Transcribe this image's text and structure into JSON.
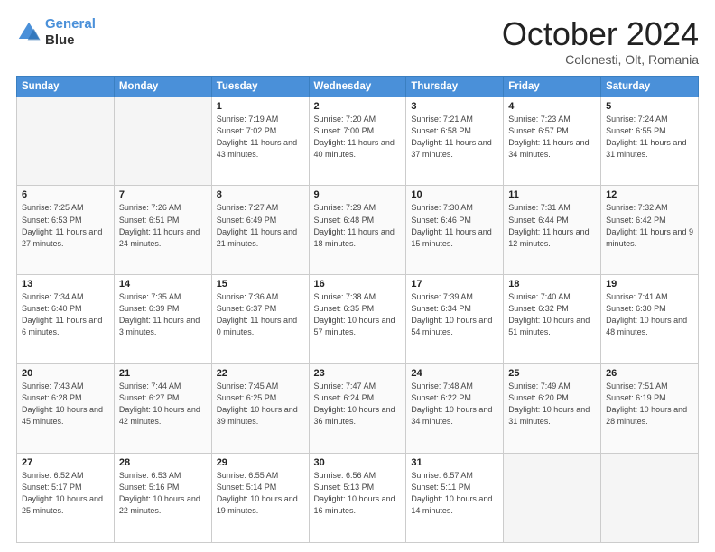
{
  "header": {
    "logo_line1": "General",
    "logo_line2": "Blue",
    "month": "October 2024",
    "location": "Colonesti, Olt, Romania"
  },
  "weekdays": [
    "Sunday",
    "Monday",
    "Tuesday",
    "Wednesday",
    "Thursday",
    "Friday",
    "Saturday"
  ],
  "weeks": [
    [
      {
        "day": "",
        "sunrise": "",
        "sunset": "",
        "daylight": ""
      },
      {
        "day": "",
        "sunrise": "",
        "sunset": "",
        "daylight": ""
      },
      {
        "day": "1",
        "sunrise": "Sunrise: 7:19 AM",
        "sunset": "Sunset: 7:02 PM",
        "daylight": "Daylight: 11 hours and 43 minutes."
      },
      {
        "day": "2",
        "sunrise": "Sunrise: 7:20 AM",
        "sunset": "Sunset: 7:00 PM",
        "daylight": "Daylight: 11 hours and 40 minutes."
      },
      {
        "day": "3",
        "sunrise": "Sunrise: 7:21 AM",
        "sunset": "Sunset: 6:58 PM",
        "daylight": "Daylight: 11 hours and 37 minutes."
      },
      {
        "day": "4",
        "sunrise": "Sunrise: 7:23 AM",
        "sunset": "Sunset: 6:57 PM",
        "daylight": "Daylight: 11 hours and 34 minutes."
      },
      {
        "day": "5",
        "sunrise": "Sunrise: 7:24 AM",
        "sunset": "Sunset: 6:55 PM",
        "daylight": "Daylight: 11 hours and 31 minutes."
      }
    ],
    [
      {
        "day": "6",
        "sunrise": "Sunrise: 7:25 AM",
        "sunset": "Sunset: 6:53 PM",
        "daylight": "Daylight: 11 hours and 27 minutes."
      },
      {
        "day": "7",
        "sunrise": "Sunrise: 7:26 AM",
        "sunset": "Sunset: 6:51 PM",
        "daylight": "Daylight: 11 hours and 24 minutes."
      },
      {
        "day": "8",
        "sunrise": "Sunrise: 7:27 AM",
        "sunset": "Sunset: 6:49 PM",
        "daylight": "Daylight: 11 hours and 21 minutes."
      },
      {
        "day": "9",
        "sunrise": "Sunrise: 7:29 AM",
        "sunset": "Sunset: 6:48 PM",
        "daylight": "Daylight: 11 hours and 18 minutes."
      },
      {
        "day": "10",
        "sunrise": "Sunrise: 7:30 AM",
        "sunset": "Sunset: 6:46 PM",
        "daylight": "Daylight: 11 hours and 15 minutes."
      },
      {
        "day": "11",
        "sunrise": "Sunrise: 7:31 AM",
        "sunset": "Sunset: 6:44 PM",
        "daylight": "Daylight: 11 hours and 12 minutes."
      },
      {
        "day": "12",
        "sunrise": "Sunrise: 7:32 AM",
        "sunset": "Sunset: 6:42 PM",
        "daylight": "Daylight: 11 hours and 9 minutes."
      }
    ],
    [
      {
        "day": "13",
        "sunrise": "Sunrise: 7:34 AM",
        "sunset": "Sunset: 6:40 PM",
        "daylight": "Daylight: 11 hours and 6 minutes."
      },
      {
        "day": "14",
        "sunrise": "Sunrise: 7:35 AM",
        "sunset": "Sunset: 6:39 PM",
        "daylight": "Daylight: 11 hours and 3 minutes."
      },
      {
        "day": "15",
        "sunrise": "Sunrise: 7:36 AM",
        "sunset": "Sunset: 6:37 PM",
        "daylight": "Daylight: 11 hours and 0 minutes."
      },
      {
        "day": "16",
        "sunrise": "Sunrise: 7:38 AM",
        "sunset": "Sunset: 6:35 PM",
        "daylight": "Daylight: 10 hours and 57 minutes."
      },
      {
        "day": "17",
        "sunrise": "Sunrise: 7:39 AM",
        "sunset": "Sunset: 6:34 PM",
        "daylight": "Daylight: 10 hours and 54 minutes."
      },
      {
        "day": "18",
        "sunrise": "Sunrise: 7:40 AM",
        "sunset": "Sunset: 6:32 PM",
        "daylight": "Daylight: 10 hours and 51 minutes."
      },
      {
        "day": "19",
        "sunrise": "Sunrise: 7:41 AM",
        "sunset": "Sunset: 6:30 PM",
        "daylight": "Daylight: 10 hours and 48 minutes."
      }
    ],
    [
      {
        "day": "20",
        "sunrise": "Sunrise: 7:43 AM",
        "sunset": "Sunset: 6:28 PM",
        "daylight": "Daylight: 10 hours and 45 minutes."
      },
      {
        "day": "21",
        "sunrise": "Sunrise: 7:44 AM",
        "sunset": "Sunset: 6:27 PM",
        "daylight": "Daylight: 10 hours and 42 minutes."
      },
      {
        "day": "22",
        "sunrise": "Sunrise: 7:45 AM",
        "sunset": "Sunset: 6:25 PM",
        "daylight": "Daylight: 10 hours and 39 minutes."
      },
      {
        "day": "23",
        "sunrise": "Sunrise: 7:47 AM",
        "sunset": "Sunset: 6:24 PM",
        "daylight": "Daylight: 10 hours and 36 minutes."
      },
      {
        "day": "24",
        "sunrise": "Sunrise: 7:48 AM",
        "sunset": "Sunset: 6:22 PM",
        "daylight": "Daylight: 10 hours and 34 minutes."
      },
      {
        "day": "25",
        "sunrise": "Sunrise: 7:49 AM",
        "sunset": "Sunset: 6:20 PM",
        "daylight": "Daylight: 10 hours and 31 minutes."
      },
      {
        "day": "26",
        "sunrise": "Sunrise: 7:51 AM",
        "sunset": "Sunset: 6:19 PM",
        "daylight": "Daylight: 10 hours and 28 minutes."
      }
    ],
    [
      {
        "day": "27",
        "sunrise": "Sunrise: 6:52 AM",
        "sunset": "Sunset: 5:17 PM",
        "daylight": "Daylight: 10 hours and 25 minutes."
      },
      {
        "day": "28",
        "sunrise": "Sunrise: 6:53 AM",
        "sunset": "Sunset: 5:16 PM",
        "daylight": "Daylight: 10 hours and 22 minutes."
      },
      {
        "day": "29",
        "sunrise": "Sunrise: 6:55 AM",
        "sunset": "Sunset: 5:14 PM",
        "daylight": "Daylight: 10 hours and 19 minutes."
      },
      {
        "day": "30",
        "sunrise": "Sunrise: 6:56 AM",
        "sunset": "Sunset: 5:13 PM",
        "daylight": "Daylight: 10 hours and 16 minutes."
      },
      {
        "day": "31",
        "sunrise": "Sunrise: 6:57 AM",
        "sunset": "Sunset: 5:11 PM",
        "daylight": "Daylight: 10 hours and 14 minutes."
      },
      {
        "day": "",
        "sunrise": "",
        "sunset": "",
        "daylight": ""
      },
      {
        "day": "",
        "sunrise": "",
        "sunset": "",
        "daylight": ""
      }
    ]
  ]
}
